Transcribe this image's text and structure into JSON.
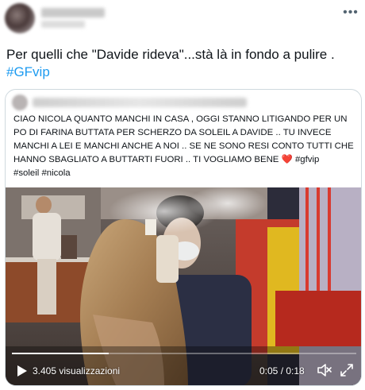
{
  "tweet": {
    "text_main": "Per quelli che \"Davide rideva\"...stà là in fondo a pulire .",
    "hashtag": "#GFvip",
    "more_icon": "more-horizontal-icon"
  },
  "quoted_tweet": {
    "text_part1": "CIAO NICOLA QUANTO MANCHI IN CASA , OGGI STANNO LITIGANDO PER UN PO DI FARINA BUTTATA PER SCHERZO DA SOLEIL A DAVIDE .. TU INVECE MANCHI A LEI E MANCHI ANCHE A NOI .. SE NE SONO RESI CONTO TUTTI CHE HANNO SBAGLIATO A BUTTARTI FUORI .. TI VOGLIAMO BENE",
    "heart": "❤️",
    "hashtag_1": "#gfvip",
    "hashtag_2": "#soleil",
    "hashtag_3": "#nicola"
  },
  "video": {
    "views": "3.405 visualizzazioni",
    "time": "0:05 / 0:18",
    "progress": 0.28,
    "play_icon": "play-icon",
    "volume_icon": "volume-icon",
    "fullscreen_icon": "fullscreen-icon"
  },
  "colors": {
    "hashtag": "#1d9bf0",
    "border": "#cfd9de",
    "heart": "#e0245e"
  }
}
